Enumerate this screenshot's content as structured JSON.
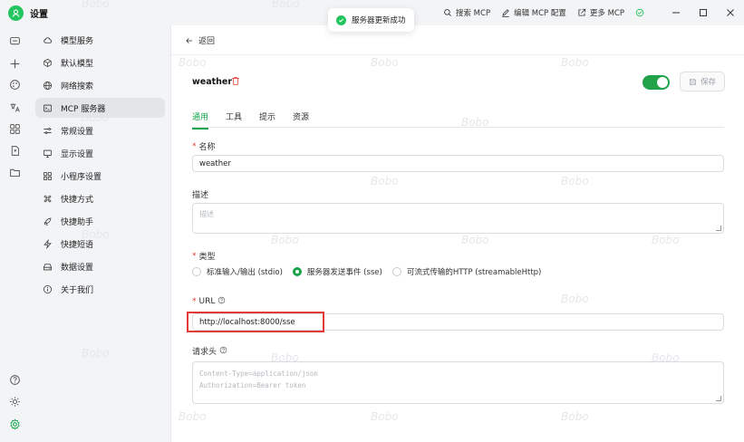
{
  "app": {
    "title": "设置"
  },
  "toast": {
    "message": "服务器更新成功"
  },
  "titlebar": {
    "search_mcp": "搜索 MCP",
    "edit_mcp_config": "编辑 MCP 配置",
    "more_mcp": "更多 MCP"
  },
  "menu": {
    "items": [
      {
        "label": "模型服务",
        "icon": "cloud-icon"
      },
      {
        "label": "默认模型",
        "icon": "cube-icon"
      },
      {
        "label": "网络搜索",
        "icon": "globe-icon"
      },
      {
        "label": "MCP 服务器",
        "icon": "terminal-icon"
      },
      {
        "label": "常规设置",
        "icon": "sliders-icon"
      },
      {
        "label": "显示设置",
        "icon": "monitor-icon"
      },
      {
        "label": "小程序设置",
        "icon": "grid-icon"
      },
      {
        "label": "快捷方式",
        "icon": "command-icon"
      },
      {
        "label": "快捷助手",
        "icon": "rocket-icon"
      },
      {
        "label": "快捷短语",
        "icon": "zap-icon"
      },
      {
        "label": "数据设置",
        "icon": "drive-icon"
      },
      {
        "label": "关于我们",
        "icon": "info-icon"
      }
    ],
    "active_index": 3
  },
  "main": {
    "back_label": "返回",
    "server_name": "weather",
    "enabled": true,
    "save_label": "保存",
    "tabs": [
      "通用",
      "工具",
      "提示",
      "资源"
    ],
    "active_tab": 0,
    "fields": {
      "name_label": "名称",
      "name_value": "weather",
      "description_label": "描述",
      "description_placeholder": "描述",
      "type_label": "类型",
      "type_options": [
        "标准输入/输出 (stdio)",
        "服务器发送事件 (sse)",
        "可流式传输的HTTP (streamableHttp)"
      ],
      "type_selected": 1,
      "url_label": "URL",
      "url_value": "http://localhost:8000/sse",
      "headers_label": "请求头",
      "headers_placeholder_line1": "Content-Type=application/json",
      "headers_placeholder_line2": "Authorization=Bearer token"
    }
  },
  "watermark": "Bobo",
  "colors": {
    "accent": "#16a34a",
    "toggle_on": "#22a34a",
    "required": "#e53935",
    "highlight_box": "#e53935"
  }
}
